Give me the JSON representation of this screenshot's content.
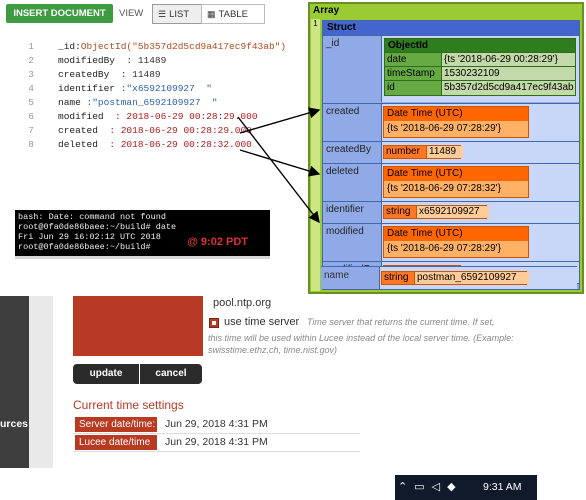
{
  "toolbar": {
    "insert_label": "INSERT DOCUMENT",
    "view_label": "VIEW",
    "list_label": "LIST",
    "table_label": "TABLE"
  },
  "document": {
    "lines": [
      {
        "n": "1",
        "key": "_id:",
        "value": "ObjectId(\"5b357d2d5cd9a417ec9f43ab\")",
        "kind": "oid"
      },
      {
        "n": "2",
        "key": "modifiedBy",
        "value": ": 11489",
        "kind": "num"
      },
      {
        "n": "3",
        "key": "createdBy",
        "value": ": 11489",
        "kind": "num"
      },
      {
        "n": "4",
        "key": "identifier",
        "value": ":\"x6592109927  \"",
        "kind": "str"
      },
      {
        "n": "5",
        "key": "name",
        "value": ":\"postman_6592109927  \"",
        "kind": "str"
      },
      {
        "n": "6",
        "key": "modified",
        "value": ": 2018-06-29 00:28:29.000",
        "kind": "date"
      },
      {
        "n": "7",
        "key": "created",
        "value": ": 2018-06-29 00:28:29.000",
        "kind": "date"
      },
      {
        "n": "8",
        "key": "deleted",
        "value": ": 2018-06-29 00:28:32.000",
        "kind": "date"
      }
    ]
  },
  "terminal": {
    "lines": [
      "bash: Date: command not found",
      "root@0fa0de86baee:~/build# date",
      "Fri Jun 29 16:02:12 UTC 2018",
      "root@0fa0de86baee:~/build#"
    ],
    "stamp": "@ 9:02 PDT"
  },
  "dump": {
    "title": "Array",
    "index": "1",
    "struct_title": "Struct",
    "id_key": "_id",
    "objectid": {
      "title": "ObjectId",
      "rows": [
        {
          "k": "date",
          "v": "{ts '2018-06-29 00:28:29'}"
        },
        {
          "k": "timeStamp",
          "v": "1530232109"
        },
        {
          "k": "id",
          "v": "5b357d2d5cd9a417ec9f43ab"
        }
      ]
    },
    "created": {
      "key": "created",
      "type": "Date Time (UTC)",
      "value": "{ts '2018-06-29 07:28:29'}"
    },
    "createdBy": {
      "key": "createdBy",
      "type": "number",
      "value": "11489"
    },
    "deleted": {
      "key": "deleted",
      "type": "Date Time (UTC)",
      "value": "{ts '2018-06-29 07:28:32'}"
    },
    "identifier": {
      "key": "identifier",
      "type": "string",
      "value": "x6592109927"
    },
    "modified": {
      "key": "modified",
      "type": "Date Time (UTC)",
      "value": "{ts '2018-06-29 07:28:29'}"
    },
    "modifiedBy": {
      "key": "modifiedBy",
      "type": "number",
      "value": "11489"
    },
    "name": {
      "key": "name",
      "type": "string",
      "value": "postman_6592109927"
    }
  },
  "admin": {
    "sidebar_label": "urces",
    "server_value": "pool.ntp.org",
    "use_time_server_label": "use time server",
    "use_time_server_desc": "Time server that returns the current time. If set,",
    "use_time_server_desc2": "this time will be used within Lucee instead of the local server time. (Example: swisstime.ethz.ch, time.nist.gov)",
    "update_label": "update",
    "cancel_label": "cancel",
    "current_title": "Current time settings",
    "rows": [
      {
        "k": "Server date/time:",
        "v": "Jun 29, 2018 4:31 PM"
      },
      {
        "k": "Lucee date/time",
        "v": "Jun 29, 2018 4:31 PM"
      }
    ]
  },
  "taskbar": {
    "clock": "9:31 AM"
  }
}
